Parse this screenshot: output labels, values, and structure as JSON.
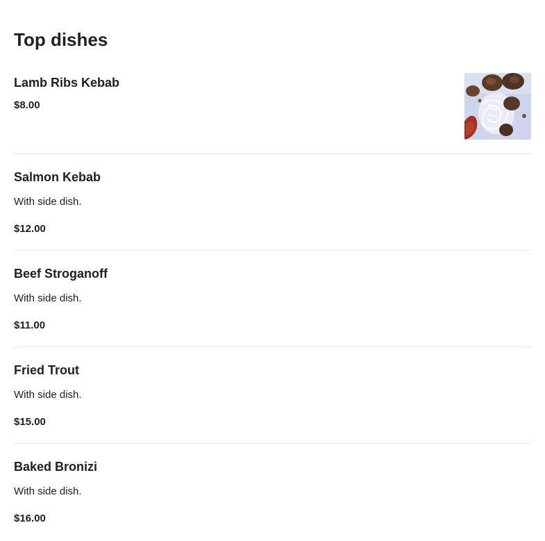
{
  "page": {
    "title": "Top dishes"
  },
  "dishes": [
    {
      "name": "Lamb Ribs Kebab",
      "description": "",
      "price": "$8.00",
      "has_image": true
    },
    {
      "name": "Salmon Kebab",
      "description": "With side dish.",
      "price": "$12.00",
      "has_image": false
    },
    {
      "name": "Beef Stroganoff",
      "description": "With side dish.",
      "price": "$11.00",
      "has_image": false
    },
    {
      "name": "Fried Trout",
      "description": "With side dish.",
      "price": "$15.00",
      "has_image": false
    },
    {
      "name": "Baked Bronizi",
      "description": "With side dish.",
      "price": "$16.00",
      "has_image": false
    }
  ]
}
